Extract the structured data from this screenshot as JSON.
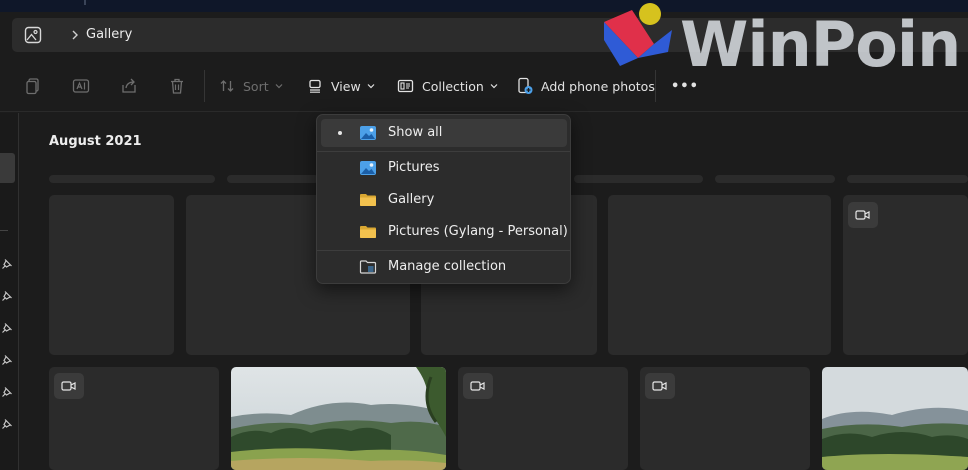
{
  "address_bar": {
    "breadcrumb": "Gallery",
    "icons": [
      "gallery-icon",
      "chevron-right-icon"
    ]
  },
  "toolbar": {
    "sort_label": "Sort",
    "view_label": "View",
    "collection_label": "Collection",
    "add_phone_photos_label": "Add phone photos",
    "more_label": "•••",
    "icons": [
      "copy-icon",
      "rename-icon",
      "share-icon",
      "delete-icon",
      "sort-icon",
      "view-icon",
      "collection-icon",
      "add-phone-photos-icon",
      "more-icon"
    ],
    "disabled_color": "#6e6e6e"
  },
  "gallery": {
    "month_heading": "August 2021"
  },
  "collection_menu": {
    "items": [
      {
        "label": "Show all",
        "icon": "pictures-icon",
        "selected": true
      },
      {
        "label": "Pictures",
        "icon": "pictures-icon",
        "selected": false
      },
      {
        "label": "Gallery",
        "icon": "folder-icon",
        "selected": false
      },
      {
        "label": "Pictures (Gylang - Personal)",
        "icon": "folder-icon",
        "selected": false
      },
      {
        "label": "Manage collection",
        "icon": "manage-collection-icon",
        "selected": false
      }
    ]
  },
  "watermark": {
    "text": "WinPoin",
    "colors": {
      "blue": "#2f5bd6",
      "red": "#e0304a",
      "yellow": "#d6c21e"
    }
  },
  "colors": {
    "background": "#1c1c1c",
    "surface": "#2c2c2c",
    "tile": "#2b2b2b",
    "accent_blue": "#4ca0e8",
    "folder_yellow": "#f2c14e"
  }
}
